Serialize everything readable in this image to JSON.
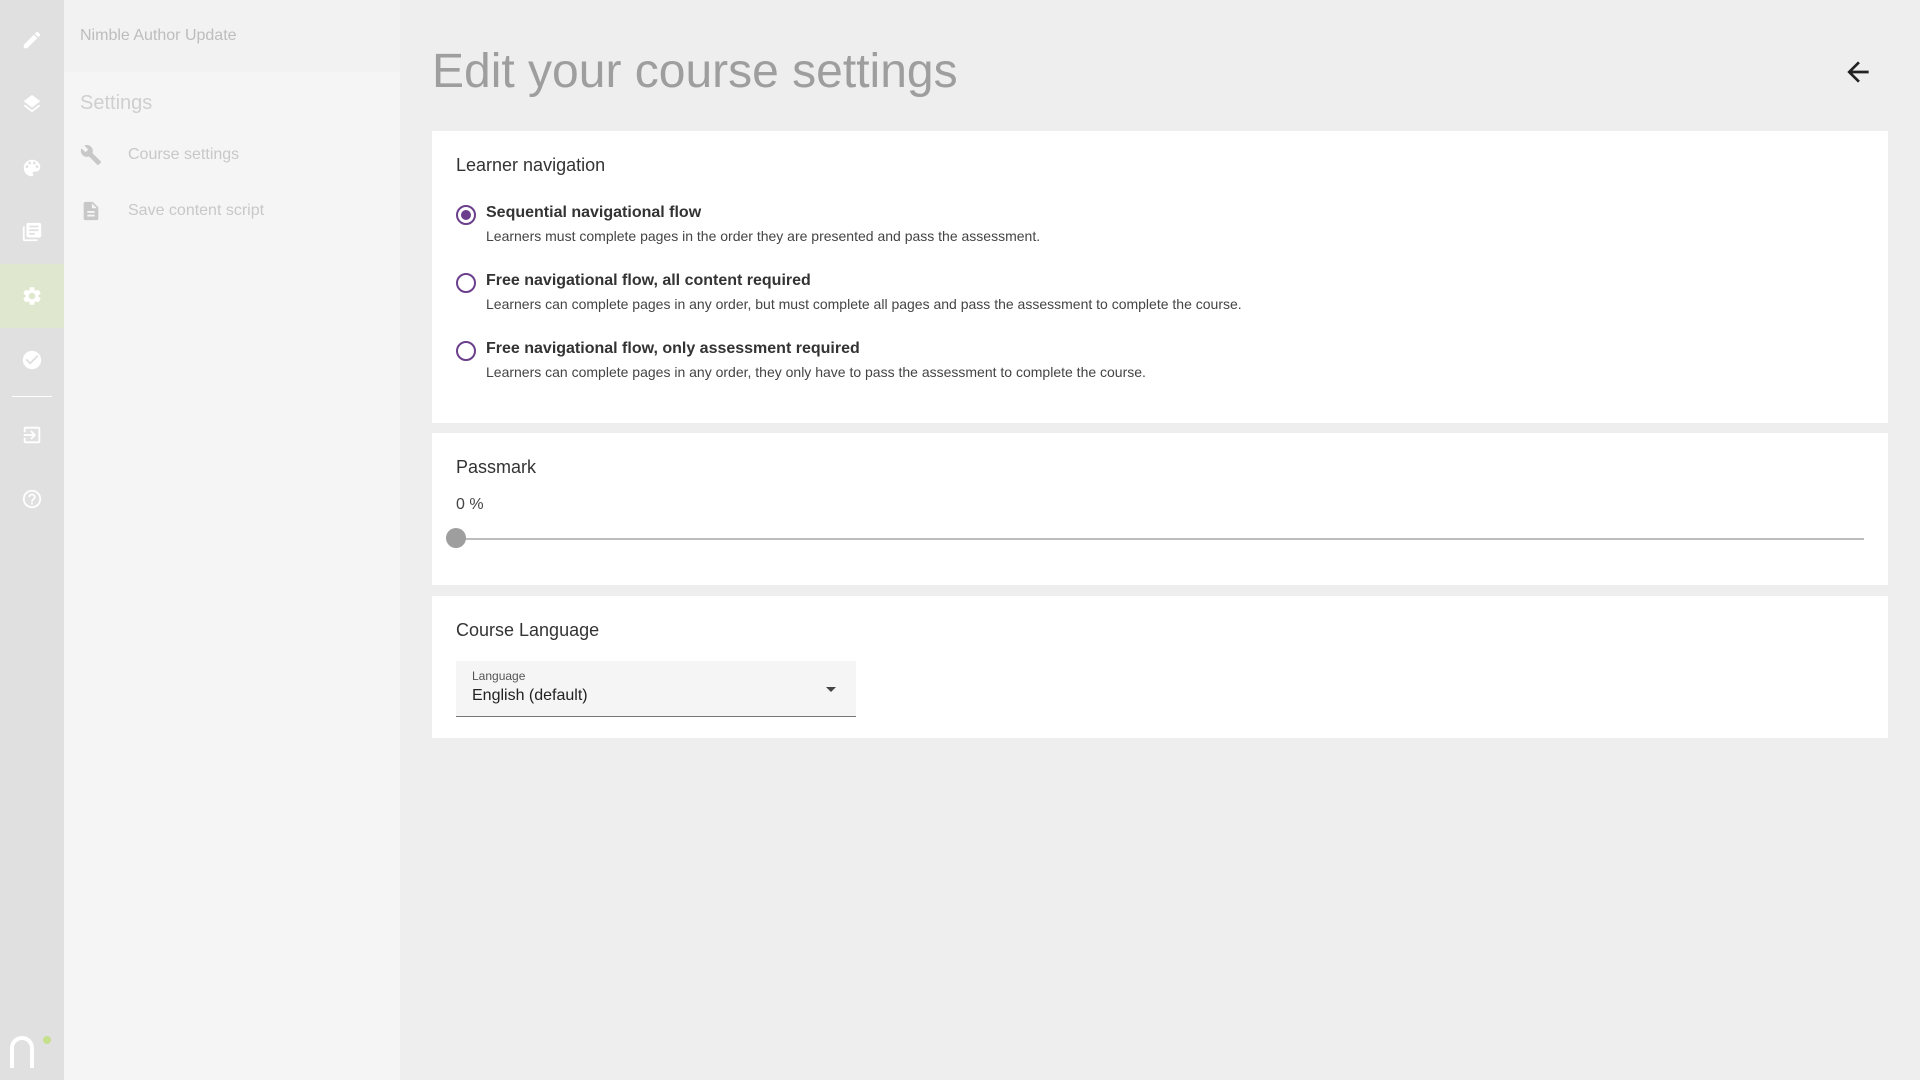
{
  "app": {
    "project_name": "Nimble Author Update",
    "section_title": "Settings"
  },
  "rail": {
    "items": [
      {
        "icon": "pencil-icon"
      },
      {
        "icon": "layers-icon"
      },
      {
        "icon": "palette-icon"
      },
      {
        "icon": "library-books-icon"
      },
      {
        "icon": "gear-icon",
        "active": true
      },
      {
        "icon": "check-circle-icon"
      },
      {
        "icon": "exit-to-app-icon"
      },
      {
        "icon": "help-icon"
      }
    ],
    "logo": "nimble-logo",
    "accent_color": "#dfe8cf"
  },
  "panel": {
    "items": [
      {
        "label": "Course settings",
        "icon": "wrench-icon"
      },
      {
        "label": "Save content script",
        "icon": "document-icon"
      }
    ]
  },
  "main": {
    "title": "Edit your course settings",
    "back_icon": "arrow-back-icon",
    "learner_navigation": {
      "title": "Learner navigation",
      "options": [
        {
          "label": "Sequential navigational flow",
          "description": "Learners must complete pages in the order they are presented and pass the assessment.",
          "selected": true
        },
        {
          "label": "Free navigational flow, all content required",
          "description": "Learners can complete pages in any order, but must complete all pages and pass the assessment to complete the course.",
          "selected": false
        },
        {
          "label": "Free navigational flow, only assessment required",
          "description": "Learners can complete pages in any order, they only have to pass the assessment to complete the course.",
          "selected": false
        }
      ]
    },
    "passmark": {
      "title": "Passmark",
      "value_text": "0 %",
      "value": 0
    },
    "course_language": {
      "title": "Course Language",
      "field_label": "Language",
      "selected": "English (default)"
    },
    "radio_color": "#6b3f8c"
  }
}
